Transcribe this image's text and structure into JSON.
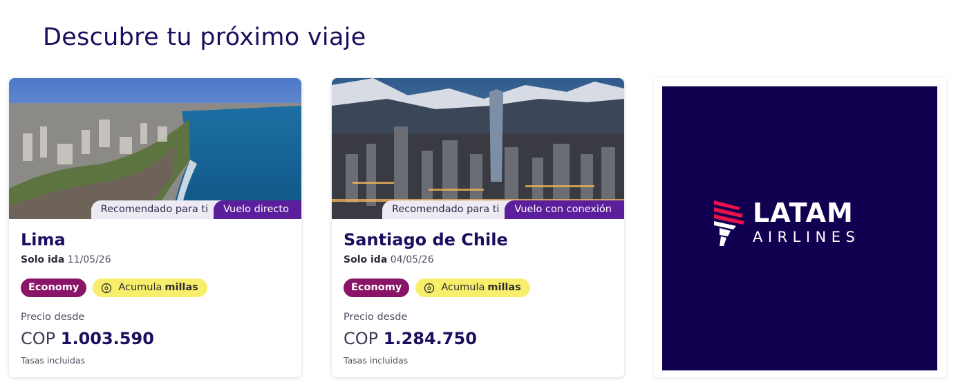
{
  "page": {
    "title": "Descubre tu próximo viaje"
  },
  "cards": [
    {
      "recommended": "Recomendado para ti",
      "flight_type": "Vuelo directo",
      "city": "Lima",
      "trip_type": "Solo ida",
      "date": "11/05/26",
      "cabin": "Economy",
      "miles_prefix": "Acumula",
      "miles_bold": "millas",
      "price_label": "Precio desde",
      "currency": "COP",
      "amount": "1.003.590",
      "taxes": "Tasas incluidas"
    },
    {
      "recommended": "Recomendado para ti",
      "flight_type": "Vuelo con conexión",
      "city": "Santiago de Chile",
      "trip_type": "Solo ida",
      "date": "04/05/26",
      "cabin": "Economy",
      "miles_prefix": "Acumula",
      "miles_bold": "millas",
      "price_label": "Precio desde",
      "currency": "COP",
      "amount": "1.284.750",
      "taxes": "Tasas incluidas"
    }
  ],
  "ad": {
    "brand": "LATAM",
    "brand_sub": "AIRLINES"
  },
  "colors": {
    "title": "#1b0e5e",
    "flight_type_pill": "#5c1f9b",
    "economy_tag": "#8a1468",
    "miles_tag": "#f7ef6c",
    "ad_background": "#10004f",
    "logo_red": "#e8114b"
  },
  "icons": {
    "miles": "miles-coin-icon",
    "logo": "latam-logo-icon"
  }
}
